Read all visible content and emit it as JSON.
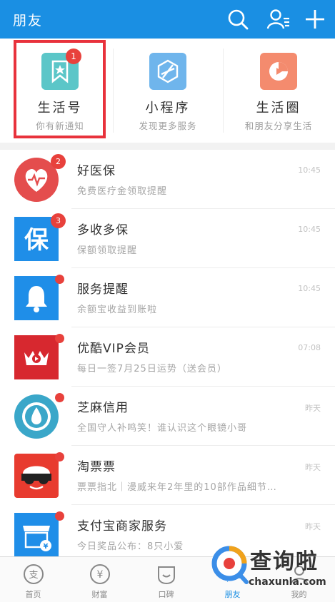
{
  "header": {
    "title": "朋友"
  },
  "services": [
    {
      "name": "生活号",
      "desc": "你有新通知",
      "badge": "1"
    },
    {
      "name": "小程序",
      "desc": "发现更多服务"
    },
    {
      "name": "生活圈",
      "desc": "和朋友分享生活"
    }
  ],
  "messages": [
    {
      "name": "好医保",
      "sub": "免费医疗金领取提醒",
      "time": "10:45",
      "badge": "2"
    },
    {
      "name": "多收多保",
      "sub": "保额领取提醒",
      "time": "10:45",
      "badge": "3"
    },
    {
      "name": "服务提醒",
      "sub": "余额宝收益到账啦",
      "time": "10:45"
    },
    {
      "name": "优酷VIP会员",
      "sub": "每日一签7月25日运势（送会员）",
      "time": "07:08"
    },
    {
      "name": "芝麻信用",
      "sub": "全国守人补鸣笑！谁认识这个眼镜小哥",
      "time": "昨天"
    },
    {
      "name": "淘票票",
      "sub": "票票指北｜漫威来年2年里的10部作品细节…",
      "time": "昨天"
    },
    {
      "name": "支付宝商家服务",
      "sub": "今日奖品公布：8只小爱",
      "time": "昨天"
    }
  ],
  "tabs": [
    {
      "label": "首页"
    },
    {
      "label": "财富"
    },
    {
      "label": "口碑"
    },
    {
      "label": "朋友"
    },
    {
      "label": "我的"
    }
  ],
  "watermark": {
    "text": "查询啦",
    "url": "chaxunla.com"
  },
  "colors": {
    "brand_blue": "#1a8fe3",
    "badge_red": "#e8413c",
    "highlight_red": "#e8323c"
  }
}
